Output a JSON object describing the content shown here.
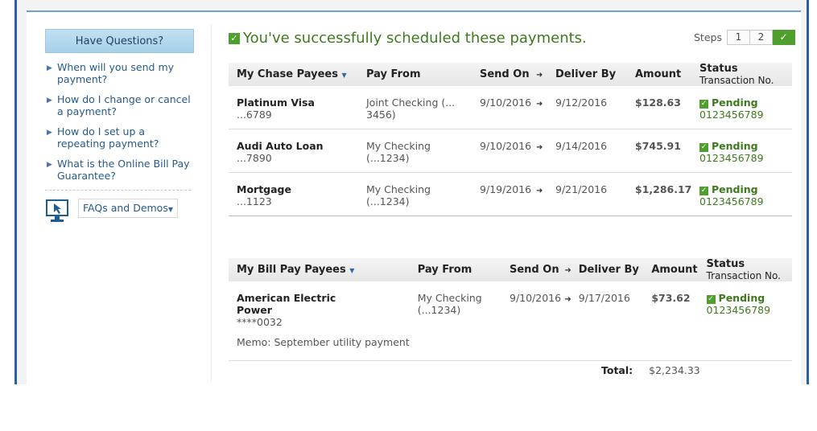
{
  "sidebar": {
    "heading": "Have Questions?",
    "questions": [
      {
        "label": "When will you send my payment?"
      },
      {
        "label": "How do I change or cancel a payment?"
      },
      {
        "label": "How do I set up a repeating payment?"
      },
      {
        "label": "What is the Online Bill Pay Guarantee?"
      }
    ],
    "faq_label": "FAQs and Demos"
  },
  "success_message": "You've successfully scheduled these payments.",
  "steps": {
    "label": "Steps",
    "items": [
      "1",
      "2"
    ],
    "done_symbol": "✓"
  },
  "chase_table": {
    "headers": {
      "payee": "My Chase Payees",
      "pay_from": "Pay From",
      "send_on": "Send On",
      "deliver_by": "Deliver By",
      "amount": "Amount",
      "status": "Status",
      "status_sub": "Transaction No."
    },
    "rows": [
      {
        "payee": "Platinum Visa",
        "acct": "...6789",
        "pay_from": "Joint Checking (... 3456)",
        "send_on": "9/10/2016",
        "deliver_by": "9/12/2016",
        "amount": "$128.63",
        "status": "Pending",
        "txn": "0123456789"
      },
      {
        "payee": "Audi Auto Loan",
        "acct": "...7890",
        "pay_from": "My Checking (...1234)",
        "send_on": "9/10/2016",
        "deliver_by": "9/14/2016",
        "amount": "$745.91",
        "status": "Pending",
        "txn": "0123456789"
      },
      {
        "payee": "Mortgage",
        "acct": "...1123",
        "pay_from": "My Checking (...1234)",
        "send_on": "9/19/2016",
        "deliver_by": "9/21/2016",
        "amount": "$1,286.17",
        "status": "Pending",
        "txn": "0123456789"
      }
    ]
  },
  "billpay_table": {
    "headers": {
      "payee": "My Bill Pay Payees",
      "pay_from": "Pay From",
      "send_on": "Send On",
      "deliver_by": "Deliver By",
      "amount": "Amount",
      "status": "Status",
      "status_sub": "Transaction No."
    },
    "rows": [
      {
        "payee": "American Electric Power",
        "acct": "****0032",
        "pay_from": "My Checking (...1234)",
        "send_on": "9/10/2016",
        "deliver_by": "9/17/2016",
        "amount": "$73.62",
        "status": "Pending",
        "txn": "0123456789",
        "memo": "Memo: September utility payment"
      }
    ]
  },
  "total": {
    "label": "Total:",
    "value": "$2,234.33"
  },
  "colors": {
    "accent": "#2b5f9e",
    "success": "#3e7a1d",
    "check": "#4f9f2f"
  }
}
